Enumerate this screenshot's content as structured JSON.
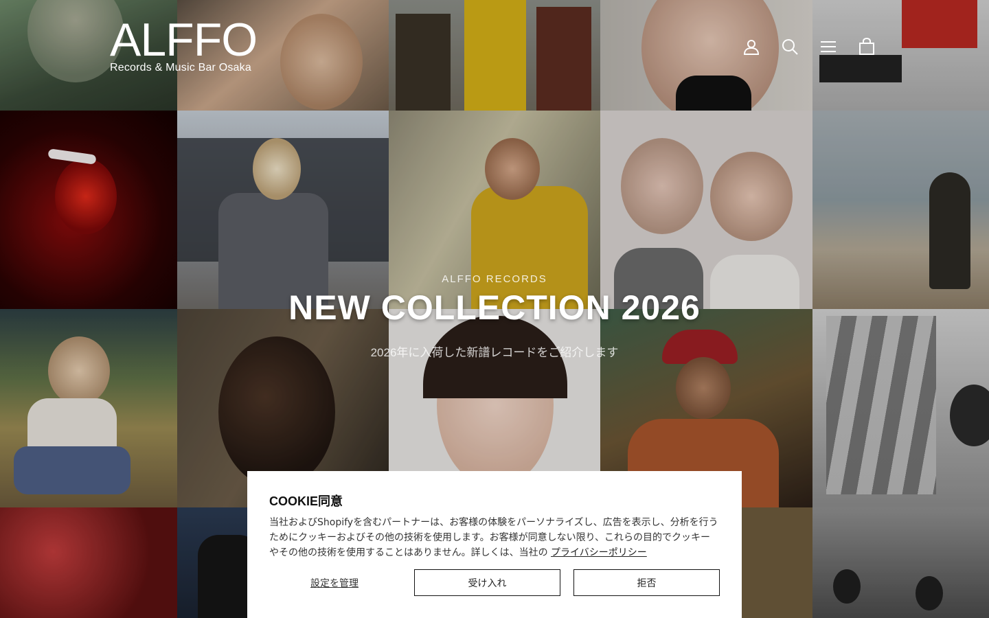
{
  "brand": {
    "logo_mark": "ALFFO",
    "logo_sub": "Records & Music Bar Osaka"
  },
  "nav": {
    "icons": [
      "account-icon",
      "search-icon",
      "menu-icon",
      "cart-icon"
    ]
  },
  "hero": {
    "eyebrow": "ALFFO RECORDS",
    "title": "NEW COLLECTION 2026",
    "subtitle": "2026年に入荷した新譜レコードをご紹介します"
  },
  "cookie": {
    "title": "COOKIE同意",
    "body": "当社およびShopifyを含むパートナーは、お客様の体験をパーソナライズし、広告を表示し、分析を行うためにクッキーおよびその他の技術を使用します。お客様が同意しない限り、これらの目的でクッキーやその他の技術を使用することはありません。詳しくは、当社の",
    "link": "プライバシーポリシー",
    "manage_label": "設定を管理",
    "accept_label": "受け入れ",
    "decline_label": "拒否"
  }
}
